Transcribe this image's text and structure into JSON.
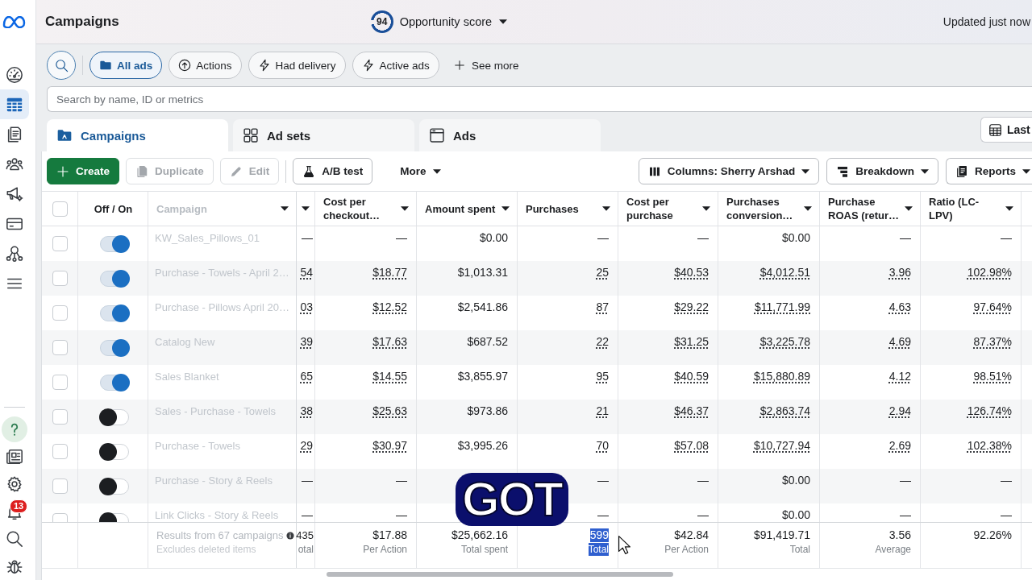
{
  "sidebar": {
    "top_items": [
      {
        "selected": false
      },
      {
        "selected": true
      },
      {
        "selected": false
      },
      {
        "selected": false
      },
      {
        "selected": false
      },
      {
        "selected": false
      },
      {
        "selected": false
      },
      {
        "selected": false
      }
    ],
    "bottom_items": [
      {
        "selected": false
      },
      {
        "selected": false
      },
      {
        "selected": false
      },
      {
        "selected": false,
        "badge": "13"
      },
      {
        "selected": false
      },
      {
        "selected": false
      }
    ]
  },
  "header": {
    "title": "Campaigns",
    "opportunity_score": {
      "value": "94",
      "label": "Opportunity score"
    },
    "updated": "Updated just now"
  },
  "filters": {
    "chips": [
      {
        "label": "All ads",
        "selected": true
      },
      {
        "label": "Actions",
        "selected": false
      },
      {
        "label": "Had delivery",
        "selected": false
      },
      {
        "label": "Active ads",
        "selected": false
      }
    ],
    "see_more": "See more"
  },
  "search": {
    "placeholder": "Search by name, ID or metrics"
  },
  "level_tabs": [
    {
      "label": "Campaigns",
      "selected": true
    },
    {
      "label": "Ad sets",
      "selected": false
    },
    {
      "label": "Ads",
      "selected": false
    }
  ],
  "date_button": {
    "label": "Last"
  },
  "toolbar": {
    "edit_actions": [
      {
        "kind": "primary",
        "label": "Create",
        "disabled": false
      },
      {
        "kind": "outlined",
        "label": "Duplicate",
        "disabled": true
      },
      {
        "kind": "outlined",
        "label": "Edit",
        "disabled": true
      }
    ],
    "more_actions": [
      {
        "kind": "outlined",
        "label": "A/B test",
        "disabled": false
      },
      {
        "kind": "menu",
        "label": "More",
        "disabled": false
      }
    ],
    "view_actions": [
      {
        "label": "Columns: Sherry Arshad"
      },
      {
        "label": "Breakdown"
      },
      {
        "label": "Reports"
      }
    ]
  },
  "table": {
    "header_checkbox": {
      "checked": false
    },
    "toggle_heading": "Off / On",
    "campaign_heading": "Campaign",
    "metric_columns": [
      "Cost per checkout…",
      "Amount spent",
      "Purchases",
      "Cost per purchase",
      "Purchases conversion…",
      "Purchase ROAS (retur…",
      "Ratio (LC-LPV)"
    ],
    "rows": [
      {
        "checked": false,
        "on": true,
        "campaign": "KW_Sales_Pillows_01",
        "column_3": {
          "text": "—",
          "underlined": false
        },
        "cost_per_checkout": {
          "text": "—",
          "underlined": false
        },
        "amount_spent": {
          "text": "$0.00",
          "underlined": false
        },
        "purchases": {
          "text": "—",
          "underlined": false
        },
        "cost_per_purchase": {
          "text": "—",
          "underlined": false
        },
        "purchases_conversion": {
          "text": "$0.00",
          "underlined": false
        },
        "purchase_roas": {
          "text": "—",
          "underlined": false
        },
        "ratio_lc_lpv": {
          "text": "—",
          "underlined": false
        }
      },
      {
        "checked": false,
        "on": true,
        "campaign": "Purchase - Towels - April 2…",
        "column_3": {
          "text": "54",
          "underlined": true
        },
        "cost_per_checkout": {
          "text": "$18.77",
          "underlined": true
        },
        "amount_spent": {
          "text": "$1,013.31",
          "underlined": false
        },
        "purchases": {
          "text": "25",
          "underlined": true
        },
        "cost_per_purchase": {
          "text": "$40.53",
          "underlined": true
        },
        "purchases_conversion": {
          "text": "$4,012.51",
          "underlined": true
        },
        "purchase_roas": {
          "text": "3.96",
          "underlined": true
        },
        "ratio_lc_lpv": {
          "text": "102.98%",
          "underlined": true
        }
      },
      {
        "checked": false,
        "on": true,
        "campaign": "Purchase - Pillows April 20…",
        "column_3": {
          "text": "03",
          "underlined": true
        },
        "cost_per_checkout": {
          "text": "$12.52",
          "underlined": true
        },
        "amount_spent": {
          "text": "$2,541.86",
          "underlined": false
        },
        "purchases": {
          "text": "87",
          "underlined": true
        },
        "cost_per_purchase": {
          "text": "$29.22",
          "underlined": true
        },
        "purchases_conversion": {
          "text": "$11,771.99",
          "underlined": true
        },
        "purchase_roas": {
          "text": "4.63",
          "underlined": true
        },
        "ratio_lc_lpv": {
          "text": "97.64%",
          "underlined": true
        }
      },
      {
        "checked": false,
        "on": true,
        "campaign": "Catalog New",
        "column_3": {
          "text": "39",
          "underlined": true
        },
        "cost_per_checkout": {
          "text": "$17.63",
          "underlined": true
        },
        "amount_spent": {
          "text": "$687.52",
          "underlined": false
        },
        "purchases": {
          "text": "22",
          "underlined": true
        },
        "cost_per_purchase": {
          "text": "$31.25",
          "underlined": true
        },
        "purchases_conversion": {
          "text": "$3,225.78",
          "underlined": true
        },
        "purchase_roas": {
          "text": "4.69",
          "underlined": true
        },
        "ratio_lc_lpv": {
          "text": "87.37%",
          "underlined": true
        }
      },
      {
        "checked": false,
        "on": true,
        "campaign": "Sales Blanket",
        "column_3": {
          "text": "65",
          "underlined": true
        },
        "cost_per_checkout": {
          "text": "$14.55",
          "underlined": true
        },
        "amount_spent": {
          "text": "$3,855.97",
          "underlined": false
        },
        "purchases": {
          "text": "95",
          "underlined": true
        },
        "cost_per_purchase": {
          "text": "$40.59",
          "underlined": true
        },
        "purchases_conversion": {
          "text": "$15,880.89",
          "underlined": true
        },
        "purchase_roas": {
          "text": "4.12",
          "underlined": true
        },
        "ratio_lc_lpv": {
          "text": "98.51%",
          "underlined": true
        }
      },
      {
        "checked": false,
        "on": false,
        "campaign": "Sales - Purchase - Towels",
        "column_3": {
          "text": "38",
          "underlined": true
        },
        "cost_per_checkout": {
          "text": "$25.63",
          "underlined": true
        },
        "amount_spent": {
          "text": "$973.86",
          "underlined": false
        },
        "purchases": {
          "text": "21",
          "underlined": true
        },
        "cost_per_purchase": {
          "text": "$46.37",
          "underlined": true
        },
        "purchases_conversion": {
          "text": "$2,863.74",
          "underlined": true
        },
        "purchase_roas": {
          "text": "2.94",
          "underlined": true
        },
        "ratio_lc_lpv": {
          "text": "126.74%",
          "underlined": true
        }
      },
      {
        "checked": false,
        "on": false,
        "campaign": "Purchase - Towels",
        "column_3": {
          "text": "29",
          "underlined": true
        },
        "cost_per_checkout": {
          "text": "$30.97",
          "underlined": true
        },
        "amount_spent": {
          "text": "$3,995.26",
          "underlined": false
        },
        "purchases": {
          "text": "70",
          "underlined": true
        },
        "cost_per_purchase": {
          "text": "$57.08",
          "underlined": true
        },
        "purchases_conversion": {
          "text": "$10,727.94",
          "underlined": true
        },
        "purchase_roas": {
          "text": "2.69",
          "underlined": true
        },
        "ratio_lc_lpv": {
          "text": "102.38%",
          "underlined": true
        }
      },
      {
        "checked": false,
        "on": false,
        "campaign": "Purchase - Story & Reels",
        "column_3": {
          "text": "—",
          "underlined": false
        },
        "cost_per_checkout": {
          "text": "—",
          "underlined": false
        },
        "purchases": {
          "text": "—",
          "underlined": false
        },
        "cost_per_purchase": {
          "text": "—",
          "underlined": false
        },
        "purchases_conversion": {
          "text": "$0.00",
          "underlined": false
        },
        "purchase_roas": {
          "text": "—",
          "underlined": false
        },
        "ratio_lc_lpv": {
          "text": "—",
          "underlined": false
        }
      },
      {
        "checked": false,
        "on": false,
        "campaign": "Link Clicks - Story & Reels",
        "column_3": {
          "text": "—",
          "underlined": false
        },
        "cost_per_checkout": {
          "text": "—",
          "underlined": false
        },
        "purchases": {
          "text": "—",
          "underlined": false
        },
        "cost_per_purchase": {
          "text": "—",
          "underlined": false
        },
        "purchases_conversion": {
          "text": "$0.00",
          "underlined": false
        },
        "purchase_roas": {
          "text": "—",
          "underlined": false
        },
        "ratio_lc_lpv": {
          "text": "—",
          "underlined": false
        }
      }
    ],
    "footer": {
      "summary": "Results from 67 campaigns",
      "note": "Excludes deleted items",
      "column_3_total": {
        "value": "435",
        "caption": "otal",
        "selected": false
      },
      "totals": [
        {
          "value": "$17.88",
          "caption": "Per Action",
          "selected": false
        },
        {
          "value": "$25,662.16",
          "caption": "Total spent",
          "selected": false
        },
        {
          "value": "599",
          "caption": "Total",
          "selected": true
        },
        {
          "value": "$42.84",
          "caption": "Per Action",
          "selected": false
        },
        {
          "value": "$91,419.71",
          "caption": "Total",
          "selected": false
        },
        {
          "value": "3.56",
          "caption": "Average",
          "selected": false
        },
        {
          "value": "92.26%",
          "selected": false
        }
      ]
    }
  },
  "video_caption": "GOT"
}
